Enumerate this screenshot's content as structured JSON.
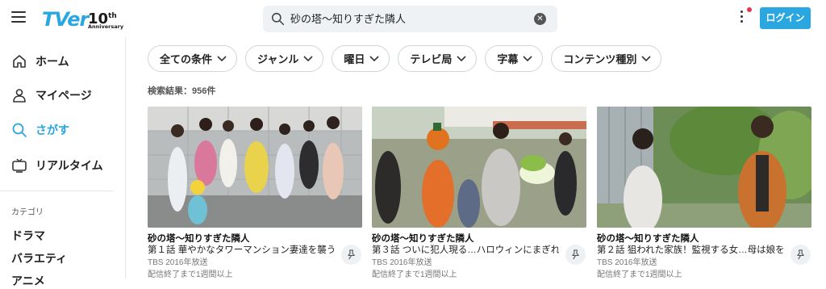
{
  "header": {
    "logo_text": "TVer",
    "logo_anniv_number": "10",
    "logo_anniv_suffix": "th",
    "logo_anniv_word": "Anniversary",
    "search_value": "砂の塔〜知りすぎた隣人",
    "login_label": "ログイン"
  },
  "sidebar": {
    "items": [
      {
        "label": "ホーム",
        "icon": "home-icon"
      },
      {
        "label": "マイページ",
        "icon": "person-icon"
      },
      {
        "label": "さがす",
        "icon": "search-icon"
      },
      {
        "label": "リアルタイム",
        "icon": "tv-icon"
      }
    ],
    "category_title": "カテゴリ",
    "categories": [
      "ドラマ",
      "バラエティ",
      "アニメ"
    ]
  },
  "filters": [
    "全ての条件",
    "ジャンル",
    "曜日",
    "テレビ局",
    "字幕",
    "コンテンツ種別"
  ],
  "results": {
    "count_label": "検索結果：956件"
  },
  "cards": [
    {
      "title": "砂の塔〜知りすぎた隣人",
      "episode": "第１話 華やかなタワーマンション妻達を襲う…",
      "meta": "TBS 2016年放送",
      "status": "配信終了まで1週間以上"
    },
    {
      "title": "砂の塔〜知りすぎた隣人",
      "episode": "第３話 ついに犯人現る…ハロウィンにまぎれ…",
      "meta": "TBS 2016年放送",
      "status": "配信終了まで1週間以上"
    },
    {
      "title": "砂の塔〜知りすぎた隣人",
      "episode": "第２話 狙われた家族！監視する女…母は娘を…",
      "meta": "TBS 2016年放送",
      "status": "配信終了まで1週間以上"
    }
  ],
  "colors": {
    "accent": "#2aa6e0",
    "notification": "#e8344e"
  }
}
